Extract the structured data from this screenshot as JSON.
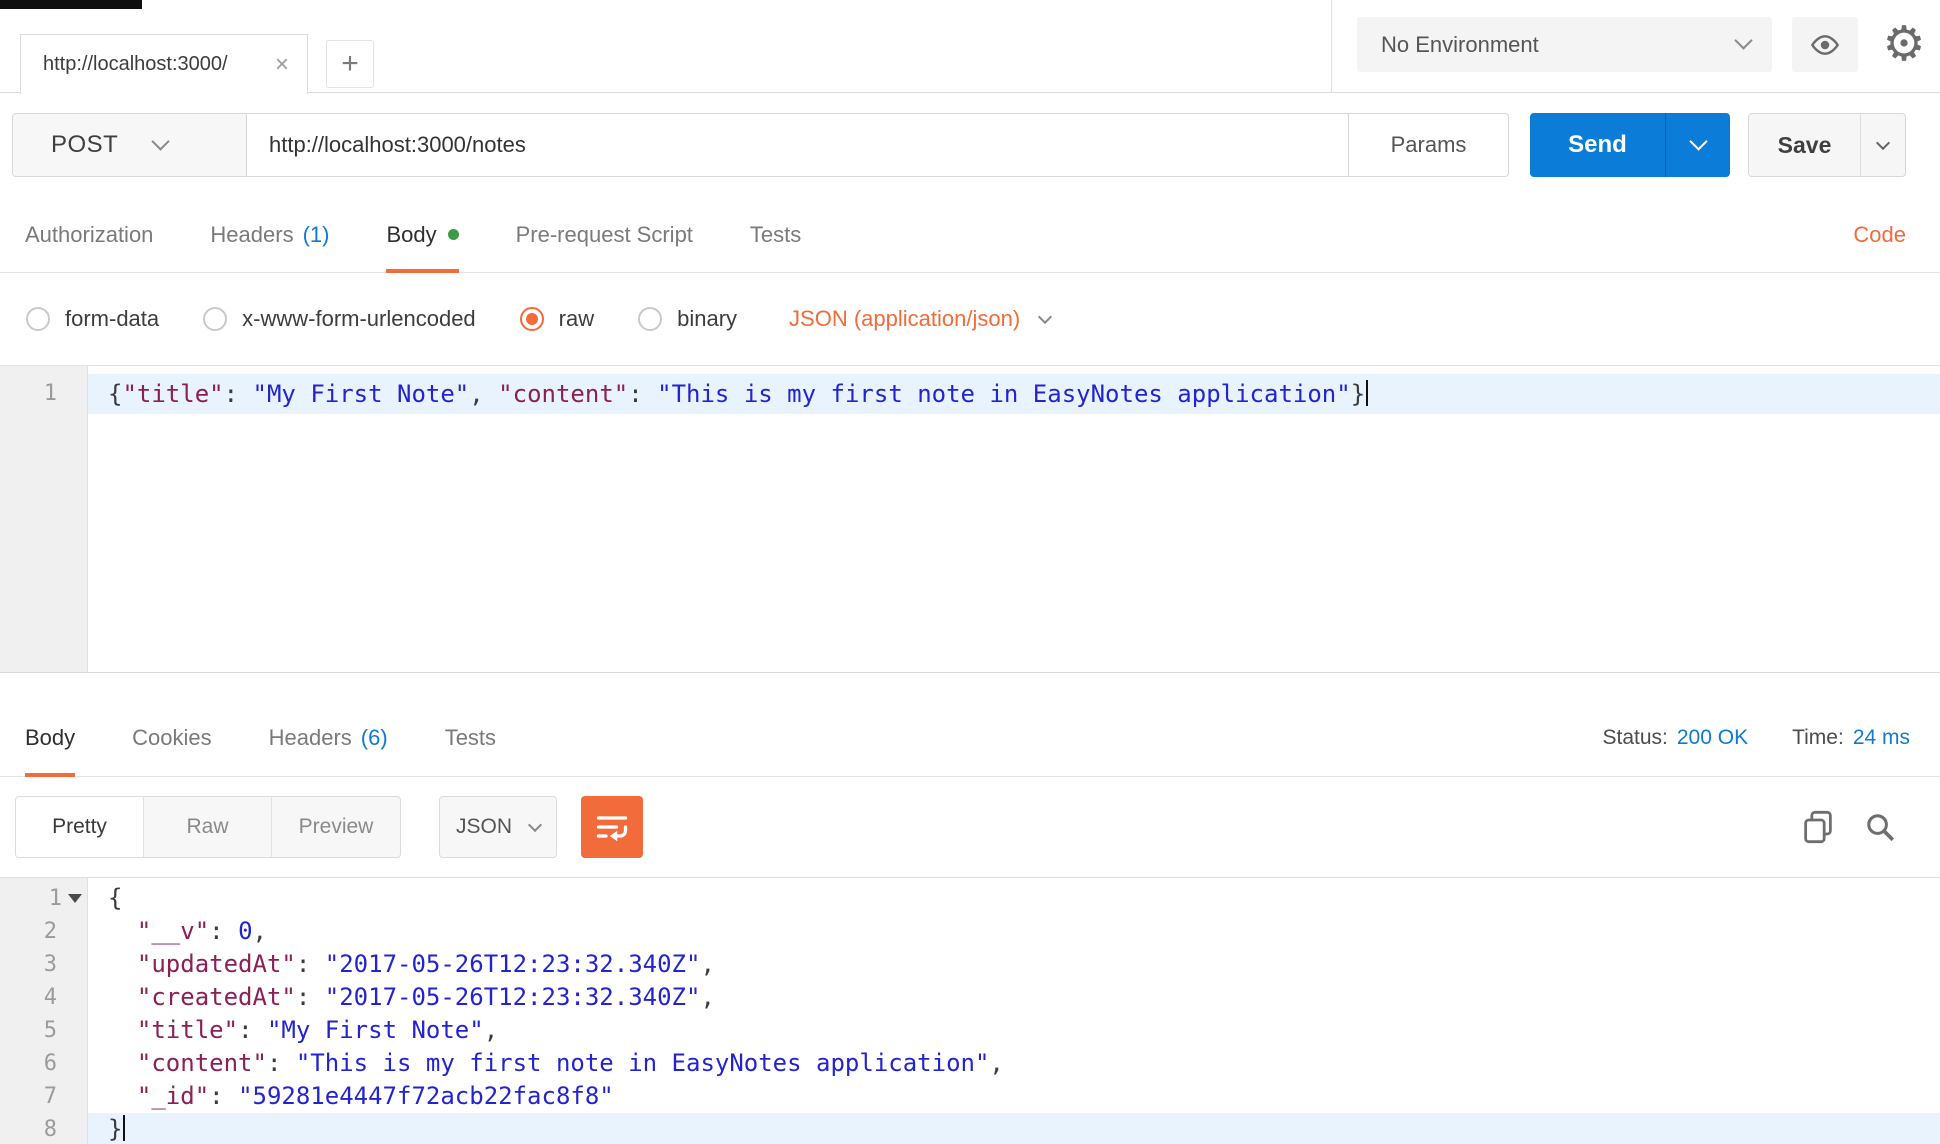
{
  "colors": {
    "accent_orange": "#f26b3b",
    "send_blue": "#0b7cd8",
    "link_blue": "#0f7ad2",
    "content_dot_green": "#3b9b46",
    "json_key": "#8b1f56",
    "json_string": "#2323d1",
    "active_line_bg": "#e8f3fd"
  },
  "chrome": {
    "tab_title": "http://localhost:3000/",
    "tab_close": "×",
    "new_tab": "+",
    "environment": "No Environment"
  },
  "request": {
    "method": "POST",
    "url": "http://localhost:3000/notes",
    "params": "Params",
    "send": "Send",
    "save": "Save",
    "tabs": {
      "authorization": "Authorization",
      "headers": "Headers",
      "headers_count": "(1)",
      "body": "Body",
      "prerequest": "Pre-request Script",
      "tests": "Tests",
      "code": "Code"
    },
    "body_modes": {
      "form_data": "form-data",
      "urlencoded": "x-www-form-urlencoded",
      "raw": "raw",
      "binary": "binary",
      "content_type": "JSON (application/json)"
    },
    "editor_lines": [
      {
        "num": "1",
        "active": true,
        "cursor": true,
        "tokens": [
          [
            "p",
            "{"
          ],
          [
            "k",
            "\"title\""
          ],
          [
            "p",
            ": "
          ],
          [
            "s",
            "\"My First Note\""
          ],
          [
            "p",
            ", "
          ],
          [
            "k",
            "\"content\""
          ],
          [
            "p",
            ": "
          ],
          [
            "s",
            "\"This is my first note in EasyNotes application\""
          ],
          [
            "p",
            "}"
          ]
        ]
      }
    ]
  },
  "response": {
    "tabs": {
      "body": "Body",
      "cookies": "Cookies",
      "headers": "Headers",
      "headers_count": "(6)",
      "tests": "Tests"
    },
    "status_label": "Status:",
    "status_value": "200 OK",
    "time_label": "Time:",
    "time_value": "24 ms",
    "views": {
      "pretty": "Pretty",
      "raw": "Raw",
      "preview": "Preview"
    },
    "language": "JSON",
    "editor_lines": [
      {
        "num": "1",
        "fold": true,
        "tokens": [
          [
            "p",
            "{"
          ]
        ]
      },
      {
        "num": "2",
        "tokens": [
          [
            "p",
            "  "
          ],
          [
            "k",
            "\"__v\""
          ],
          [
            "p",
            ": "
          ],
          [
            "n",
            "0"
          ],
          [
            "p",
            ","
          ]
        ]
      },
      {
        "num": "3",
        "tokens": [
          [
            "p",
            "  "
          ],
          [
            "k",
            "\"updatedAt\""
          ],
          [
            "p",
            ": "
          ],
          [
            "s",
            "\"2017-05-26T12:23:32.340Z\""
          ],
          [
            "p",
            ","
          ]
        ]
      },
      {
        "num": "4",
        "tokens": [
          [
            "p",
            "  "
          ],
          [
            "k",
            "\"createdAt\""
          ],
          [
            "p",
            ": "
          ],
          [
            "s",
            "\"2017-05-26T12:23:32.340Z\""
          ],
          [
            "p",
            ","
          ]
        ]
      },
      {
        "num": "5",
        "tokens": [
          [
            "p",
            "  "
          ],
          [
            "k",
            "\"title\""
          ],
          [
            "p",
            ": "
          ],
          [
            "s",
            "\"My First Note\""
          ],
          [
            "p",
            ","
          ]
        ]
      },
      {
        "num": "6",
        "tokens": [
          [
            "p",
            "  "
          ],
          [
            "k",
            "\"content\""
          ],
          [
            "p",
            ": "
          ],
          [
            "s",
            "\"This is my first note in EasyNotes application\""
          ],
          [
            "p",
            ","
          ]
        ]
      },
      {
        "num": "7",
        "tokens": [
          [
            "p",
            "  "
          ],
          [
            "k",
            "\"_id\""
          ],
          [
            "p",
            ": "
          ],
          [
            "s",
            "\"59281e4447f72acb22fac8f8\""
          ]
        ]
      },
      {
        "num": "8",
        "active": true,
        "cursor": true,
        "tokens": [
          [
            "p",
            "}"
          ]
        ]
      }
    ]
  }
}
